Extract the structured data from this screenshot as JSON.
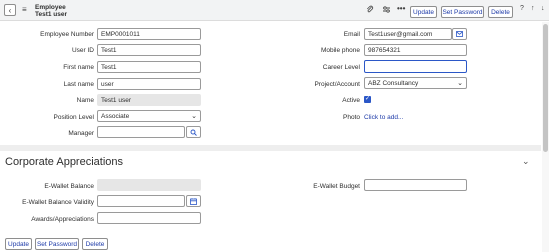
{
  "header": {
    "title_line1": "Employee",
    "title_line2": "Test1 user",
    "buttons": {
      "update": "Update",
      "set_password": "Set Password",
      "delete": "Delete"
    },
    "icons": [
      "back-icon",
      "menu-icon",
      "attachment-icon",
      "settings-icon",
      "more-icon",
      "help-icon",
      "up-arrow-icon",
      "down-arrow-icon"
    ]
  },
  "form": {
    "employee_number": {
      "label": "Employee Number",
      "value": "EMP0001011"
    },
    "user_id": {
      "label": "User ID",
      "value": "Test1"
    },
    "first_name": {
      "label": "First name",
      "value": "Test1"
    },
    "last_name": {
      "label": "Last name",
      "value": "user"
    },
    "name": {
      "label": "Name",
      "value": "Test1 user"
    },
    "position_level": {
      "label": "Position Level",
      "value": "Associate"
    },
    "manager": {
      "label": "Manager",
      "value": ""
    },
    "email": {
      "label": "Email",
      "value": "Test1user@gmail.com"
    },
    "mobile_phone": {
      "label": "Mobile phone",
      "value": "987654321"
    },
    "career_level": {
      "label": "Career Level",
      "value": ""
    },
    "project_account": {
      "label": "Project/Account",
      "value": "ABZ Consultancy"
    },
    "active": {
      "label": "Active",
      "checked": true
    },
    "photo": {
      "label": "Photo",
      "link": "Click to add..."
    }
  },
  "corporate": {
    "title": "Corporate Appreciations",
    "ewallet_balance": {
      "label": "E-Wallet Balance",
      "value": ""
    },
    "ewallet_validity": {
      "label": "E-Wallet Balance Validity",
      "value": ""
    },
    "awards": {
      "label": "Awards/Appreciations",
      "value": ""
    },
    "ewallet_budget": {
      "label": "E-Wallet Budget",
      "value": ""
    }
  },
  "footer": {
    "update": "Update",
    "set_password": "Set Password",
    "delete": "Delete"
  },
  "colors": {
    "accent": "#2b57c7",
    "link": "#1d3aa8",
    "header_bg": "#f2f3f4"
  }
}
